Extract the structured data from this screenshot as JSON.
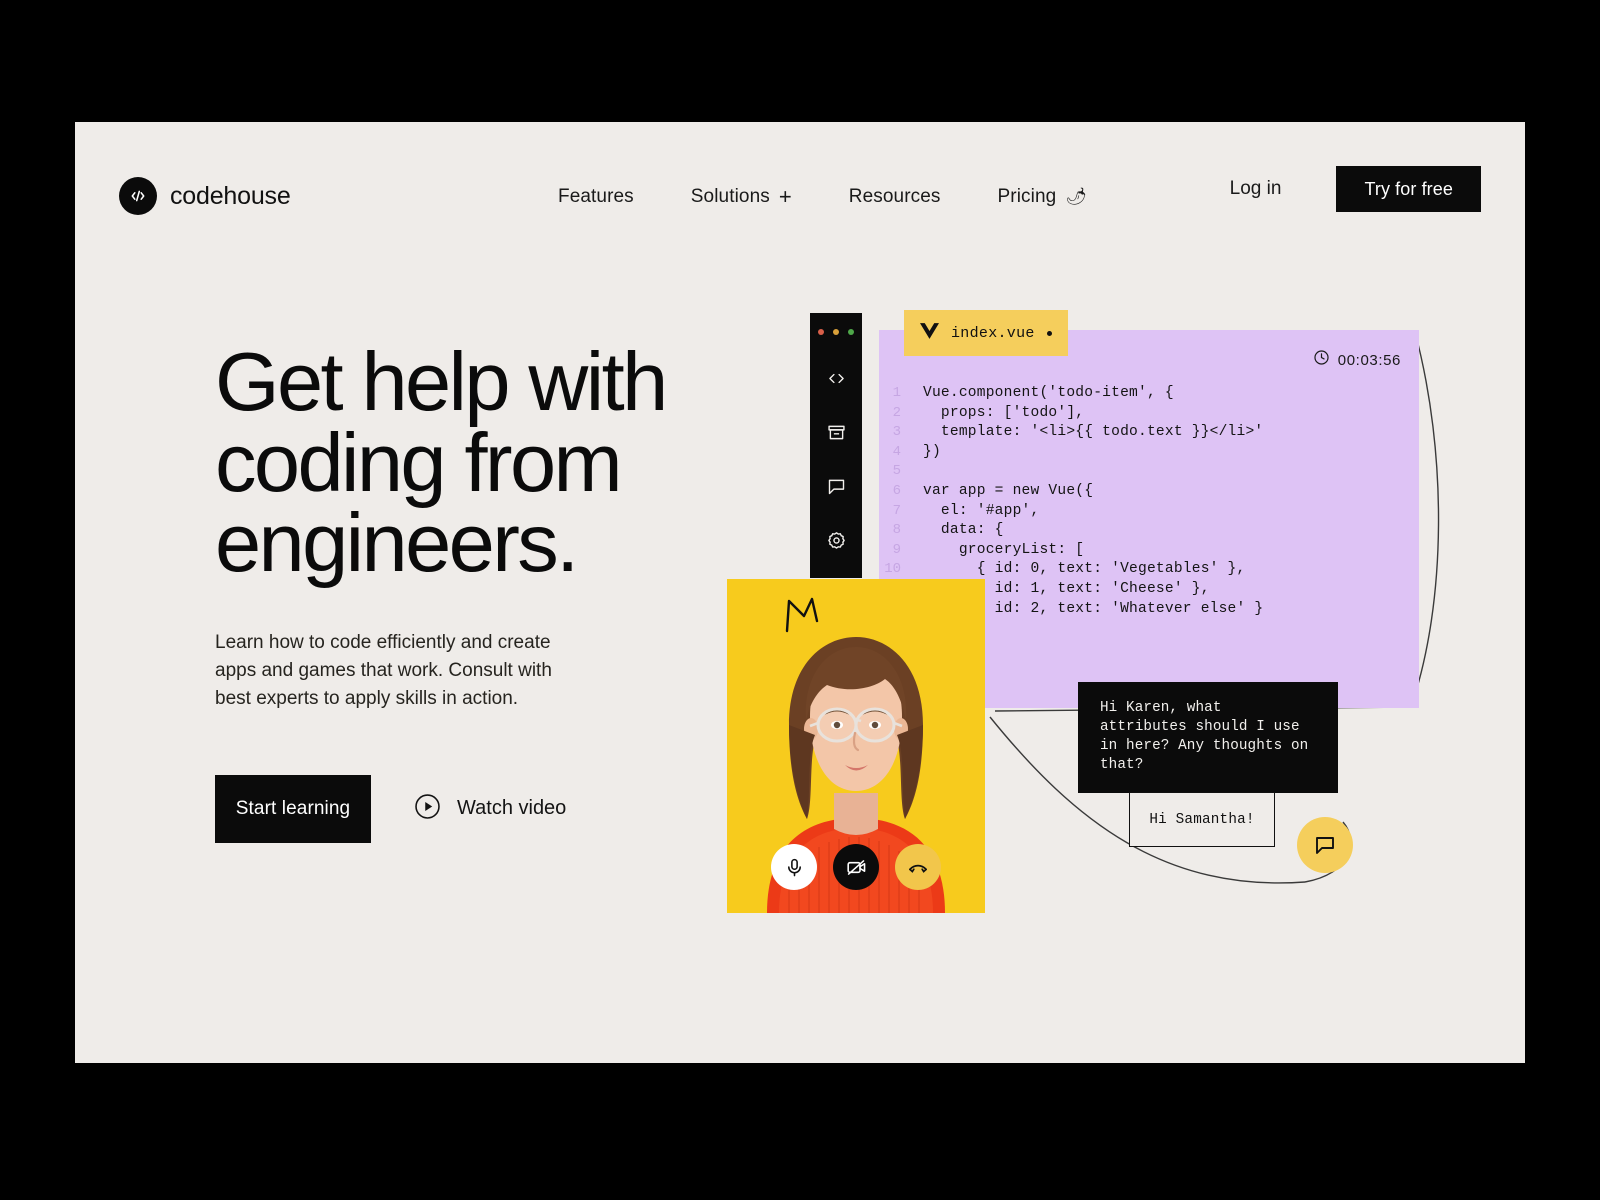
{
  "brand": {
    "name": "codehouse",
    "mark_icon": "code-brackets-icon"
  },
  "nav": {
    "items": [
      {
        "label": "Features",
        "suffix": ""
      },
      {
        "label": "Solutions",
        "suffix": "+"
      },
      {
        "label": "Resources",
        "suffix": ""
      },
      {
        "label": "Pricing",
        "emoji": "🌶"
      }
    ]
  },
  "auth": {
    "login_label": "Log in",
    "cta_label": "Try for free"
  },
  "hero": {
    "title_line1": "Get help with",
    "title_line2": "coding from",
    "title_line3": "engineers.",
    "subtitle": "Learn how to code efficiently and create apps and games that work. Consult with best experts to apply skills in action.",
    "primary_cta": "Start learning",
    "secondary_cta": "Watch video",
    "secondary_icon": "play-circle-icon"
  },
  "editor": {
    "rail": {
      "dots": [
        "#D9604A",
        "#D9A03A",
        "#4FA84A"
      ],
      "icons": [
        "code-icon",
        "archive-icon",
        "chat-bubble-icon",
        "gear-icon"
      ]
    },
    "tab": {
      "filename": "index.vue",
      "logo_icon": "vue-logo-icon",
      "modified_dot": true
    },
    "timer": {
      "icon": "clock-icon",
      "value": "00:03:56"
    },
    "panel_color": "#DEC3F5",
    "tab_color": "#F5CE5C",
    "lines": [
      {
        "n": "1",
        "code": "Vue.component('todo-item', {"
      },
      {
        "n": "2",
        "code": "  props: ['todo'],"
      },
      {
        "n": "3",
        "code": "  template: '<li>{{ todo.text }}</li>'"
      },
      {
        "n": "4",
        "code": "})"
      },
      {
        "n": "5",
        "code": ""
      },
      {
        "n": "6",
        "code": "var app = new Vue({"
      },
      {
        "n": "7",
        "code": "  el: '#app',"
      },
      {
        "n": "8",
        "code": "  data: {"
      },
      {
        "n": "9",
        "code": "    groceryList: ["
      },
      {
        "n": "10",
        "code": "      { id: 0, text: 'Vegetables' },"
      },
      {
        "n": "",
        "code": "      { id: 1, text: 'Cheese' },"
      },
      {
        "n": "",
        "code": "      { id: 2, text: 'Whatever else' }"
      },
      {
        "n": "",
        "code": "    ]"
      },
      {
        "n": "",
        "code": "  }"
      },
      {
        "n": "",
        "code": "})"
      }
    ]
  },
  "video_call": {
    "background_color": "#F7CB1D",
    "doodle": "crown-doodle",
    "controls": [
      {
        "name": "microphone-button",
        "icon": "microphone-icon"
      },
      {
        "name": "camera-off-button",
        "icon": "camera-off-icon"
      },
      {
        "name": "end-call-button",
        "icon": "phone-hangup-icon"
      }
    ]
  },
  "chat": {
    "incoming": "Hi Karen, what attributes should I use in here? Any thoughts on that?",
    "outgoing": "Hi Samantha!",
    "fab_icon": "chat-bubble-icon",
    "fab_color": "#F5CE5C"
  }
}
